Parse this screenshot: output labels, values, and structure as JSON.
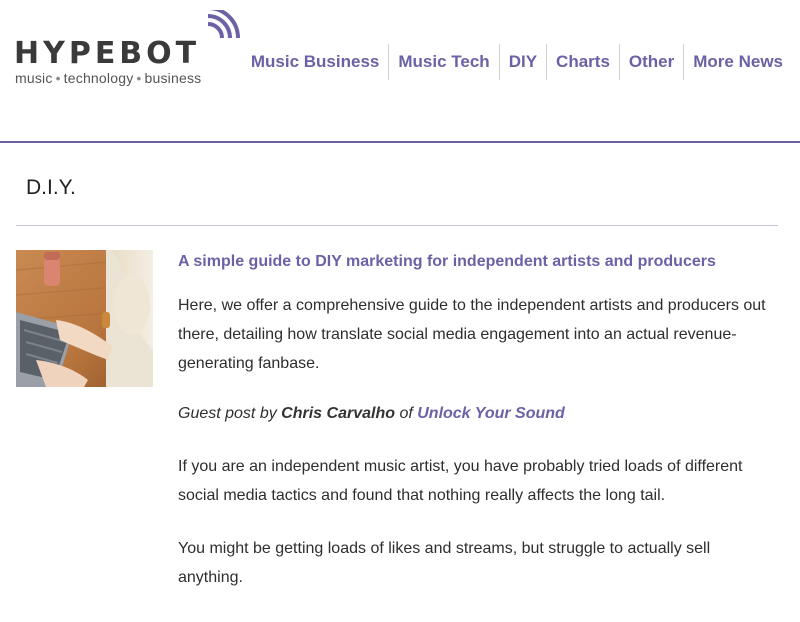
{
  "brand": {
    "name": "HYPEBOT",
    "tagline_parts": [
      "music",
      "technology",
      "business"
    ],
    "tagline_separator": "•",
    "accent_color": "#6b62a6"
  },
  "nav": {
    "items": [
      {
        "label": "Music Business"
      },
      {
        "label": "Music Tech"
      },
      {
        "label": "DIY"
      },
      {
        "label": "Charts"
      },
      {
        "label": "Other"
      },
      {
        "label": "More News"
      }
    ]
  },
  "section": {
    "title": "D.I.Y."
  },
  "article": {
    "thumbnail_icon": "laptop-photo",
    "title": "A simple guide to DIY marketing for independent artists and producers",
    "intro": "Here, we offer a comprehensive guide to the independent artists and producers out there, detailing how translate social media engagement into an actual revenue-generating fanbase.",
    "guest_prefix": "Guest post by",
    "author": "Chris Carvalho",
    "guest_of": "of",
    "source_link": "Unlock Your Sound",
    "body": [
      "If you are an independent music artist, you have probably tried loads of different social media tactics and found that nothing really affects the long tail.",
      "You might be getting loads of likes and streams, but struggle to actually sell anything."
    ]
  }
}
